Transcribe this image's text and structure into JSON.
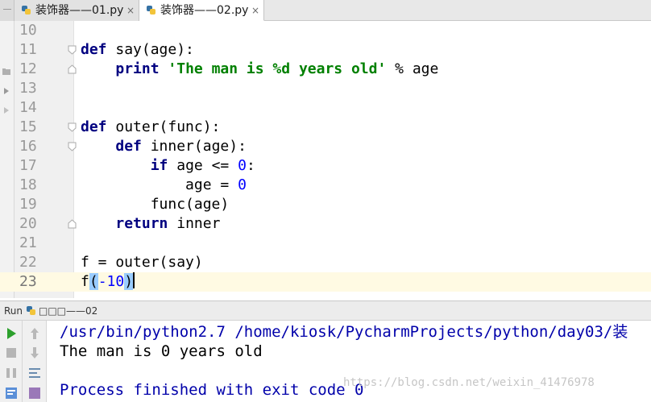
{
  "tabs": [
    {
      "label": "装饰器——01.py",
      "close": "×",
      "active": false
    },
    {
      "label": "装饰器——02.py",
      "close": "×",
      "active": true
    }
  ],
  "editor": {
    "line_numbers": [
      "10",
      "11",
      "12",
      "13",
      "14",
      "15",
      "16",
      "17",
      "18",
      "19",
      "20",
      "21",
      "22",
      "23"
    ],
    "code": {
      "l11_kw": "def",
      "l11_rest": " say(age):",
      "l12_indent": "    ",
      "l12_kw": "print",
      "l12_sp": " ",
      "l12_str": "'The man is %d years old'",
      "l12_rest": " % age",
      "l15_kw": "def",
      "l15_rest": " outer(func):",
      "l16_indent": "    ",
      "l16_kw": "def",
      "l16_rest": " inner(age):",
      "l17_indent": "        ",
      "l17_kw": "if",
      "l17_mid": " age <= ",
      "l17_num": "0",
      "l17_end": ":",
      "l18_pre": "            age = ",
      "l18_num": "0",
      "l19": "        func(age)",
      "l20_indent": "    ",
      "l20_kw": "return",
      "l20_rest": " inner",
      "l22": "f = outer(say)",
      "l23_f": "f",
      "l23_open": "(",
      "l23_num": "-10",
      "l23_close": ")"
    }
  },
  "run": {
    "label": "Run",
    "config_name": "□□□——02"
  },
  "console": {
    "cmd": "/usr/bin/python2.7 /home/kiosk/PycharmProjects/python/day03/装",
    "output": "The man is 0 years old",
    "exit": "Process finished with exit code 0"
  },
  "watermark": "https://blog.csdn.net/weixin_41476978",
  "colors": {
    "keyword": "#000080",
    "string": "#008000",
    "number": "#0000ff",
    "console_system": "#0000aa",
    "current_line": "#fffae3",
    "brace_match": "#99ccff",
    "run_green": "#2ca02c"
  }
}
